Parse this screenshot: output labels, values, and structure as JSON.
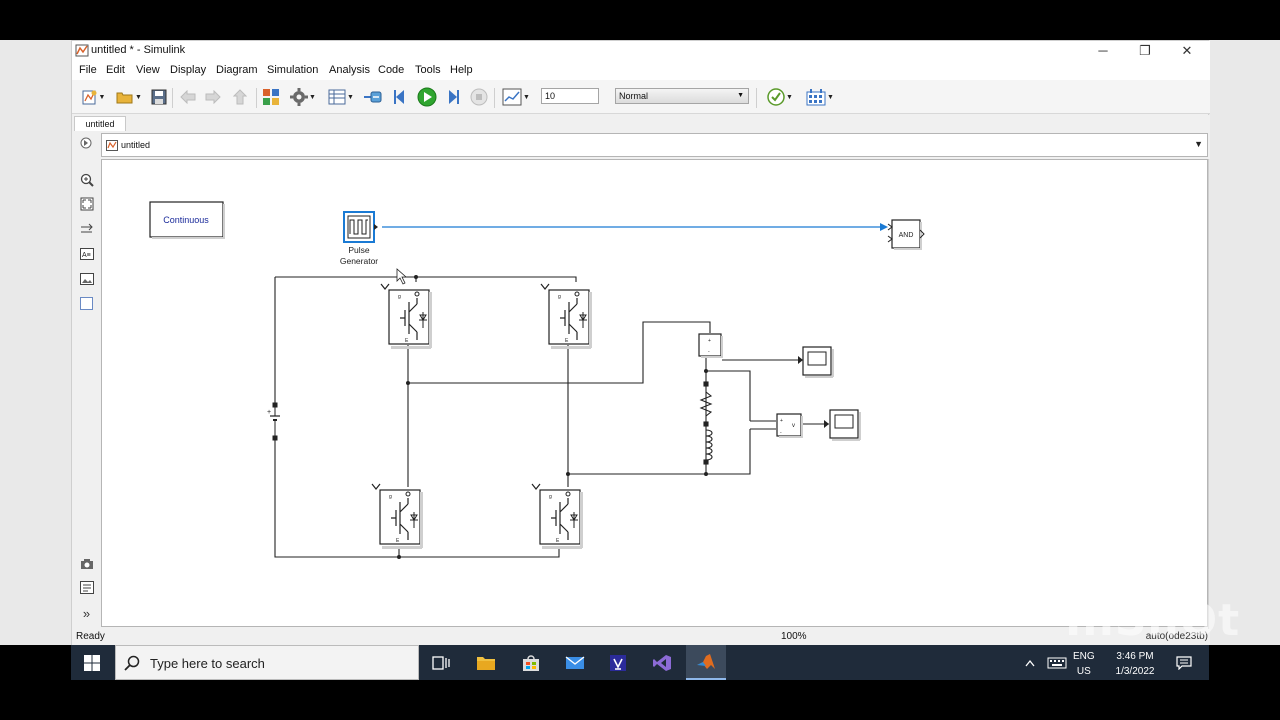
{
  "window": {
    "title": "untitled * - Simulink",
    "controls": {
      "minimize": "─",
      "maximize": "❐",
      "close": "✕"
    }
  },
  "menu": [
    "File",
    "Edit",
    "View",
    "Display",
    "Diagram",
    "Simulation",
    "Analysis",
    "Code",
    "Tools",
    "Help"
  ],
  "toolbar": {
    "stop_time": "10",
    "sim_mode": "Normal"
  },
  "tabs": {
    "model_tab": "untitled"
  },
  "address": {
    "path": "untitled"
  },
  "blocks": {
    "continuous": "Continuous",
    "pulse_line1": "Pulse",
    "pulse_line2": "Generator",
    "and": "AND",
    "igbt_c": "C",
    "igbt_g": "g",
    "igbt_e": "E",
    "vm_plus": "+",
    "vm_minus": "-",
    "vm_v": "v",
    "dc_plus": "+"
  },
  "status": {
    "ready": "Ready",
    "zoom": "100%",
    "solver": "auto(ode23tb)"
  },
  "watermark": "InShOt",
  "taskbar": {
    "search_placeholder": "Type here to search",
    "lang_top": "ENG",
    "lang_bottom": "US",
    "time": "3:46 PM",
    "date": "1/3/2022"
  },
  "colors": {
    "signal_line": "#1a7ad4",
    "taskbar": "#1f2b3a",
    "run_green": "#2fa52f"
  }
}
